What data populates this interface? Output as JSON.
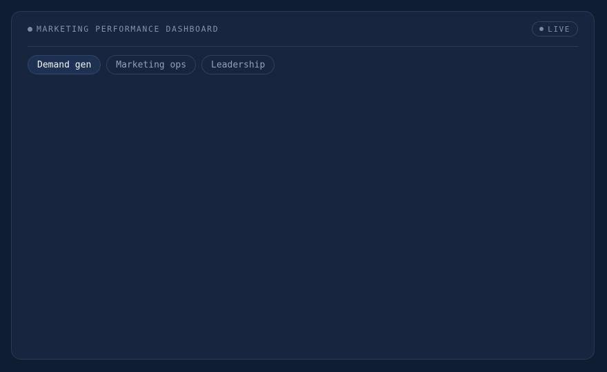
{
  "header": {
    "title": "MARKETING PERFORMANCE DASHBOARD",
    "status_label": "LIVE"
  },
  "tabs": [
    {
      "label": "Demand gen",
      "active": true
    },
    {
      "label": "Marketing ops",
      "active": false
    },
    {
      "label": "Leadership",
      "active": false
    }
  ],
  "colors": {
    "background": "#0f1d33",
    "panel": "#17263e",
    "active_tab": "#1e3152",
    "muted_text": "#8592a8"
  }
}
